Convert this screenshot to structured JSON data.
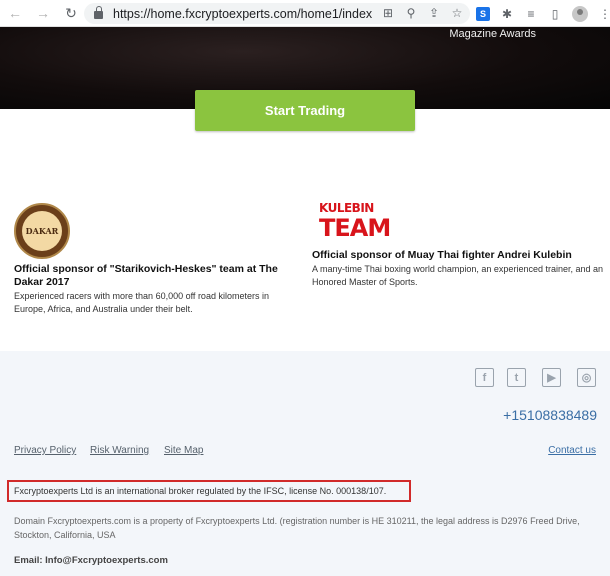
{
  "browser": {
    "url": "https://home.fxcryptoexperts.com/home1/index...",
    "back_icon": "←",
    "forward_icon": "→",
    "reload_icon": "↻"
  },
  "hero": {
    "awards_text": "Magazine Awards",
    "cta_label": "Start Trading"
  },
  "sponsors": {
    "dakar": {
      "logo_text": "DAKAR",
      "title": "Official sponsor of \"Starikovich-Heskes\" team at The Dakar 2017",
      "description": "Experienced racers with more than 60,000 off road kilometers in Europe, Africa, and Australia under their belt."
    },
    "kulebin": {
      "logo_line1": "KULEBIN",
      "logo_line2": "TEAM",
      "title": "Official sponsor of Muay Thai fighter Andrei Kulebin",
      "description": "A many-time Thai boxing world champion, an experienced trainer, and an Honored Master of Sports."
    }
  },
  "footer": {
    "social": [
      "f",
      "t",
      "▶",
      "◎"
    ],
    "phone": "+15108838489",
    "links": [
      "Privacy Policy",
      "Risk Warning",
      "Site Map"
    ],
    "contact_link": "Contact us",
    "legal_notice": "Fxcryptoexperts Ltd is an international broker regulated by the IFSC, license No. 000138/107.",
    "domain_notice": "Domain Fxcryptoexperts.com is a property of Fxcryptoexperts Ltd. (registration number is HE 310211, the legal address is D2976 Freed Drive, Stockton, California, USA",
    "email": "Email: Info@Fxcryptoexperts.com"
  },
  "colors": {
    "cta": "#8bc43f",
    "link_blue": "#3a6ea5",
    "highlight_red": "#d12a2a"
  }
}
